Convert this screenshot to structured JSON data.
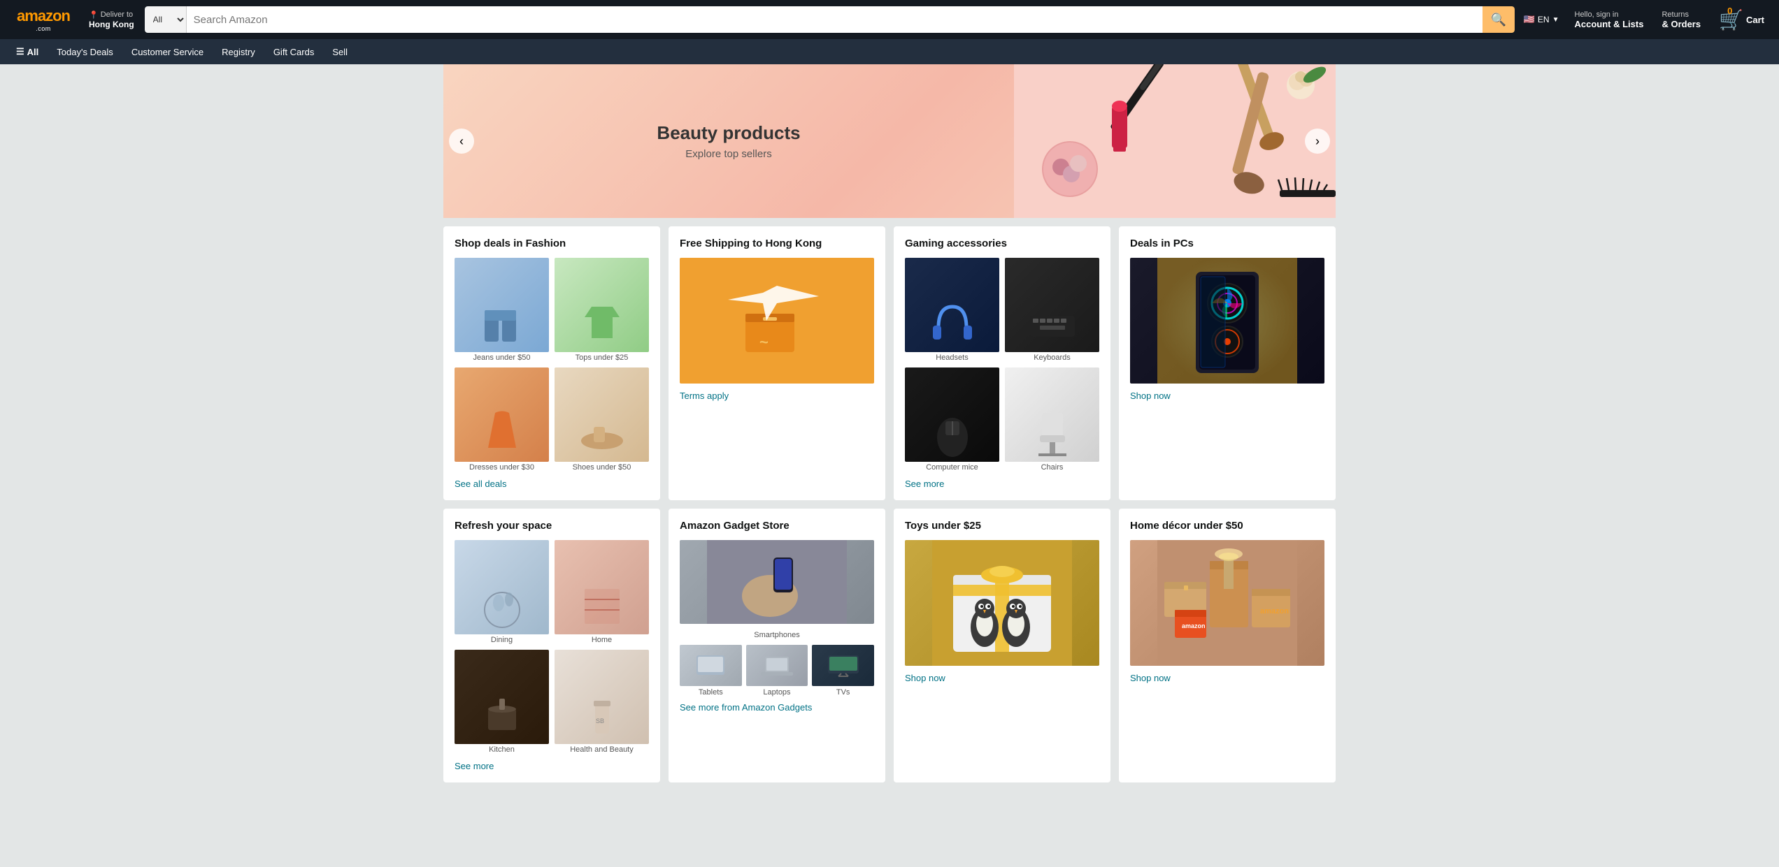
{
  "header": {
    "logo": "amazon",
    "logo_suffix": "",
    "deliver_label": "Deliver to",
    "deliver_city": "Hong Kong",
    "search_placeholder": "Search Amazon",
    "search_category": "All",
    "flag": "EN",
    "account_line1": "Hello, sign in",
    "account_line2": "Account & Lists",
    "returns_line1": "Returns",
    "returns_line2": "& Orders",
    "cart_label": "Cart",
    "cart_count": "0"
  },
  "nav": {
    "all_label": "All",
    "items": [
      "Today's Deals",
      "Customer Service",
      "Registry",
      "Gift Cards",
      "Sell"
    ]
  },
  "hero": {
    "title": "Beauty products",
    "subtitle": "Explore top sellers",
    "prev_label": "<",
    "next_label": ">"
  },
  "cards": [
    {
      "id": "fashion",
      "title": "Shop deals in Fashion",
      "items": [
        {
          "label": "Jeans under $50",
          "img_class": "img-fashion-jeans"
        },
        {
          "label": "Tops under $25",
          "img_class": "img-fashion-tops"
        },
        {
          "label": "Dresses under $30",
          "img_class": "img-fashion-dresses"
        },
        {
          "label": "Shoes under $50",
          "img_class": "img-fashion-shoes"
        }
      ],
      "link": "See all deals",
      "link_type": "text"
    },
    {
      "id": "shipping",
      "title": "Free Shipping to Hong Kong",
      "full_img": true,
      "img_class": "img-shipping",
      "link": "Terms apply",
      "link_type": "text"
    },
    {
      "id": "gaming",
      "title": "Gaming accessories",
      "items": [
        {
          "label": "Headsets",
          "img_class": "img-gaming-headset"
        },
        {
          "label": "Keyboards",
          "img_class": "img-gaming-keyboard"
        },
        {
          "label": "Computer mice",
          "img_class": "img-gaming-mouse"
        },
        {
          "label": "Chairs",
          "img_class": "img-gaming-chair"
        }
      ],
      "link": "See more",
      "link_type": "text"
    },
    {
      "id": "pcs",
      "title": "Deals in PCs",
      "full_img": true,
      "img_class": "img-pc-case",
      "link": "Shop now",
      "link_type": "text"
    },
    {
      "id": "refresh",
      "title": "Refresh your space",
      "items": [
        {
          "label": "Dining",
          "img_class": "img-home-dining"
        },
        {
          "label": "Home",
          "img_class": "img-home-textiles"
        },
        {
          "label": "Kitchen",
          "img_class": "img-home-kitchen"
        },
        {
          "label": "Health and Beauty",
          "img_class": "img-home-beauty"
        }
      ],
      "link": "See more",
      "link_type": "text"
    },
    {
      "id": "gadget",
      "title": "Amazon Gadget Store",
      "gadget": true,
      "main_img_class": "img-gadget-smartphones",
      "main_label": "Smartphones",
      "sub_items": [
        {
          "label": "Tablets",
          "img_class": "img-gadget-tablets"
        },
        {
          "label": "Laptops",
          "img_class": "img-gadget-laptops"
        },
        {
          "label": "TVs",
          "img_class": "img-gadget-tvs"
        }
      ],
      "link": "See more from Amazon Gadgets",
      "link_type": "text"
    },
    {
      "id": "toys",
      "title": "Toys under $25",
      "full_img": true,
      "img_class": "img-toys",
      "link": "Shop now",
      "link_type": "text"
    },
    {
      "id": "homedecor",
      "title": "Home décor under $50",
      "full_img": true,
      "img_class": "img-homedecor",
      "link": "Shop now",
      "link_type": "text"
    }
  ]
}
